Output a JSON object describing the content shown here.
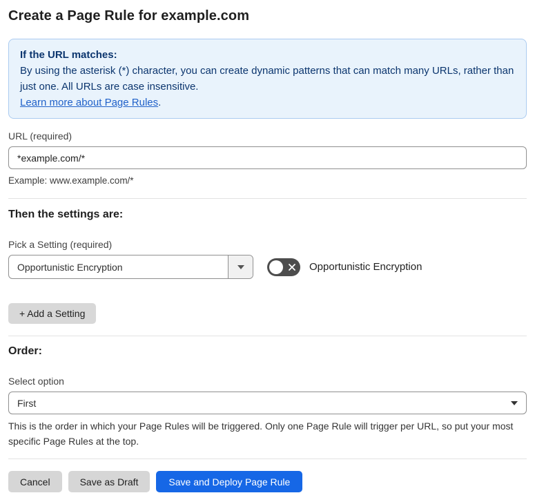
{
  "page": {
    "title": "Create a Page Rule for example.com"
  },
  "info_box": {
    "heading": "If the URL matches:",
    "body": "By using the asterisk (*) character, you can create dynamic patterns that can match many URLs, rather than just one. All URLs are case insensitive.",
    "link_label": "Learn more about Page Rules",
    "link_suffix": "."
  },
  "url_field": {
    "label": "URL (required)",
    "value": "*example.com/*",
    "hint": "Example: www.example.com/*"
  },
  "settings": {
    "heading": "Then the settings are:",
    "picker_label": "Pick a Setting (required)",
    "picker_value": "Opportunistic Encryption",
    "toggle_label": "Opportunistic Encryption",
    "toggle_state": "off",
    "add_button_label": "+ Add a Setting"
  },
  "order": {
    "heading": "Order:",
    "label": "Select option",
    "value": "First",
    "hint": "This is the order in which your Page Rules will be triggered. Only one Page Rule will trigger per URL, so put your most specific Page Rules at the top."
  },
  "footer": {
    "cancel_label": "Cancel",
    "save_draft_label": "Save as Draft",
    "save_deploy_label": "Save and Deploy Page Rule"
  },
  "colors": {
    "primary_button_blue": "#1667e6",
    "info_box_background": "#e9f3fc",
    "info_box_border": "#abcbf0",
    "info_box_text": "#0b356e",
    "link_blue": "#2061c9",
    "toggle_off_gray": "#4d4d4d"
  }
}
